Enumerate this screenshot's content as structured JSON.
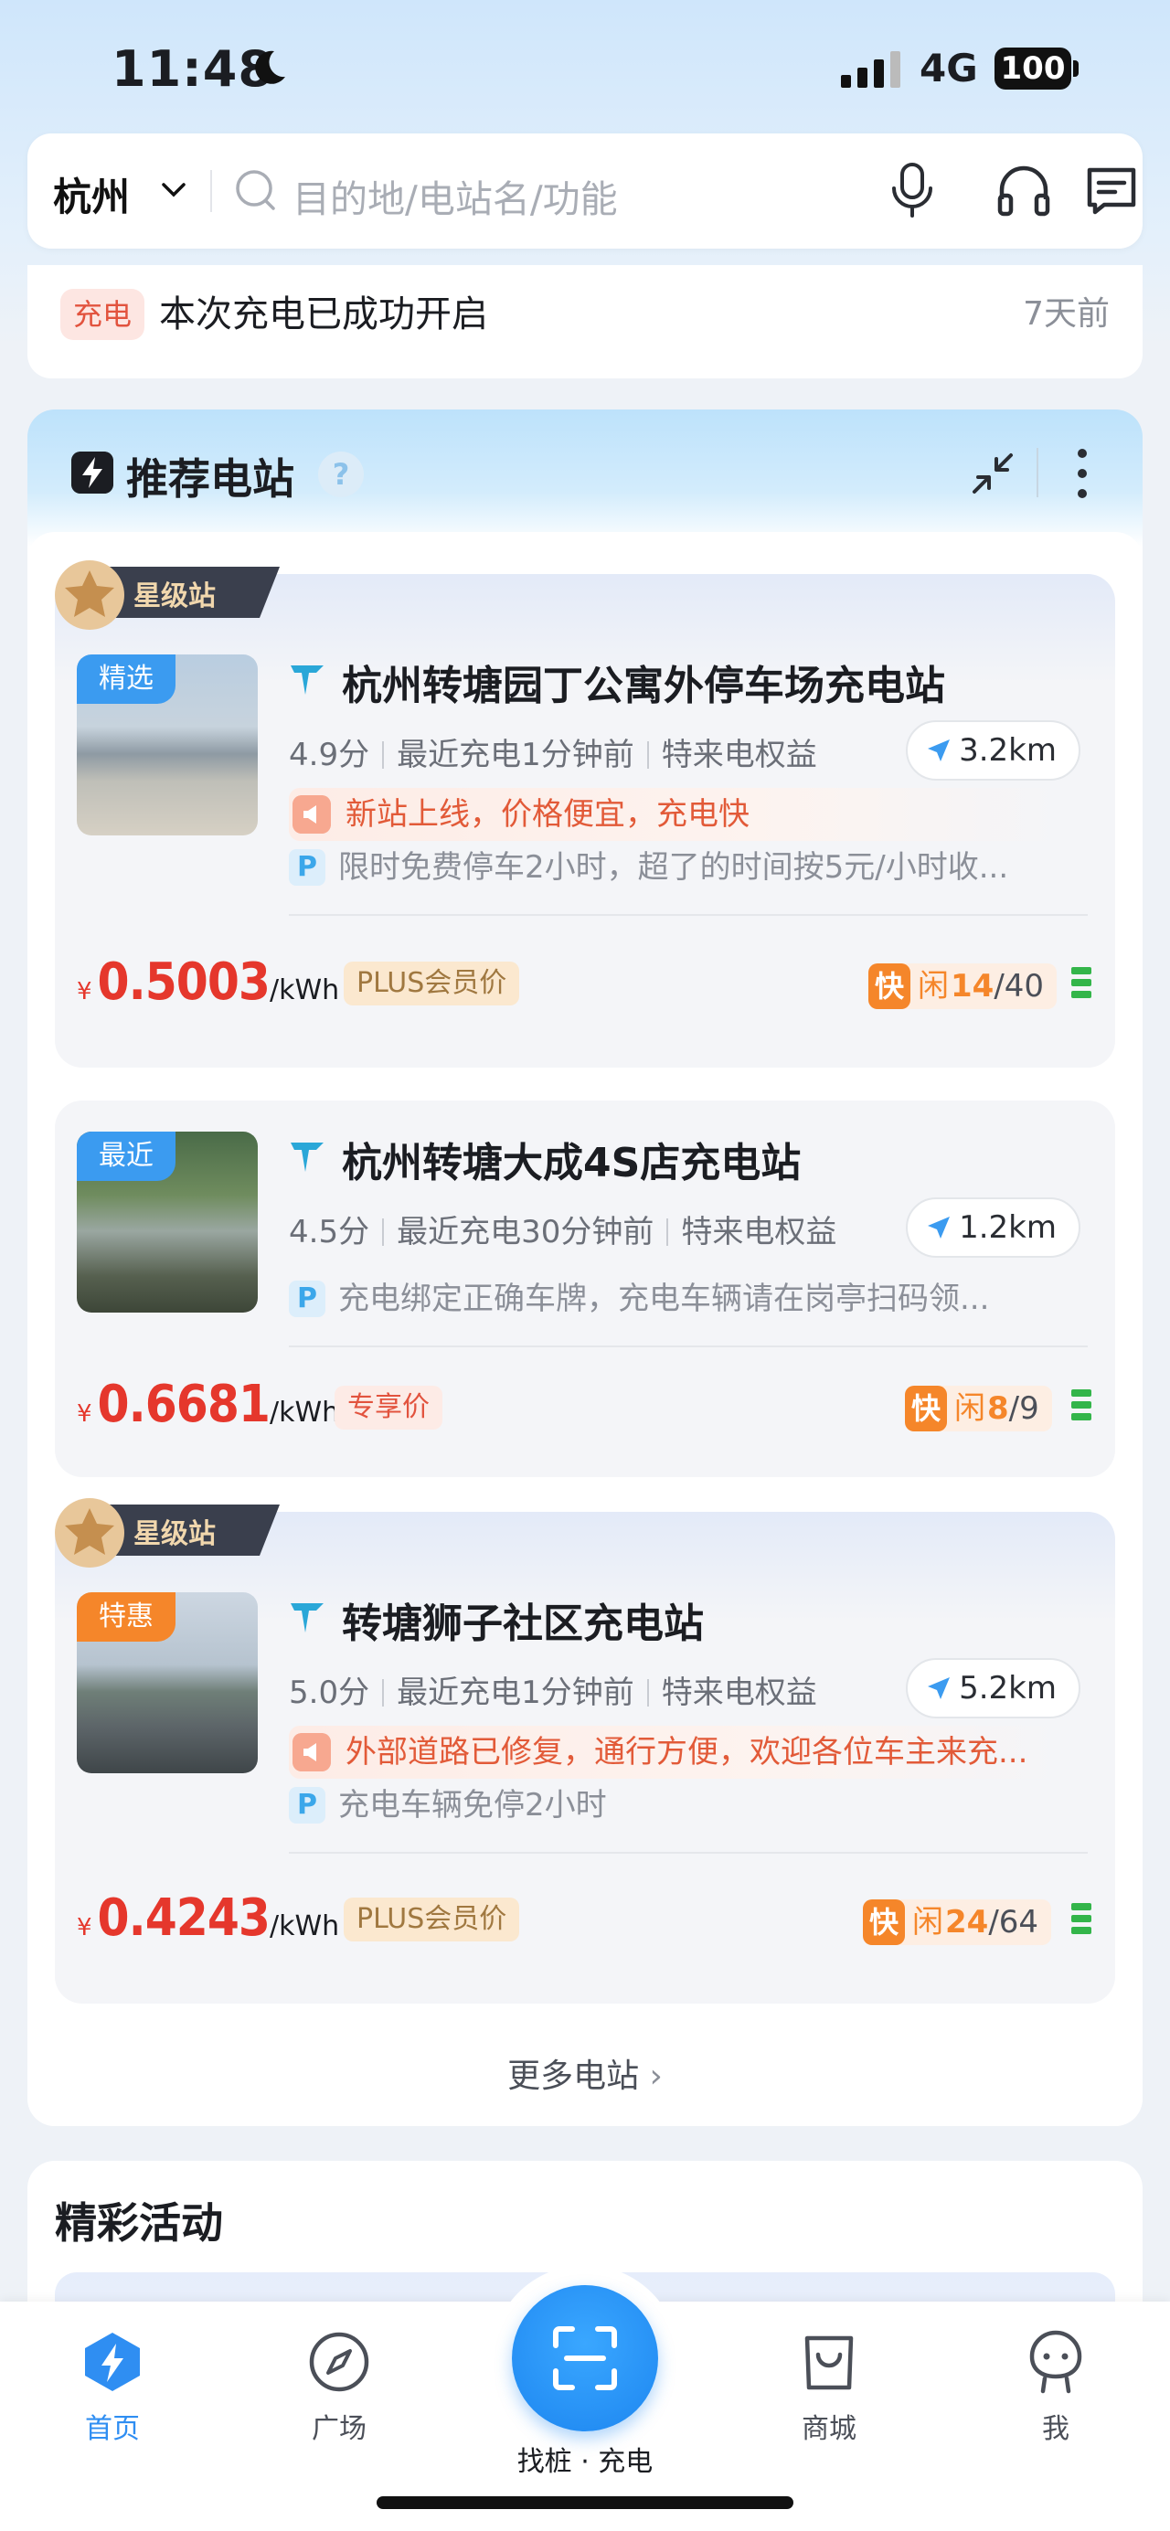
{
  "status_bar": {
    "time": "11:48",
    "network": "4G",
    "battery": "100"
  },
  "search": {
    "city": "杭州",
    "placeholder": "目的地/电站名/功能"
  },
  "notice": {
    "tag": "充电",
    "text": "本次充电已成功开启",
    "time": "7天前"
  },
  "recommend": {
    "title": "推荐电站",
    "help": "?",
    "more_label": "更多电站",
    "star_badge": "星级站",
    "stations": [
      {
        "thumb_tag": "精选",
        "thumb_tag_color": "#3b9bf0",
        "star": true,
        "name": "杭州转塘园丁公寓外停车场充电站",
        "rating": "4.9分",
        "recent": "最近充电1分钟前",
        "benefit": "特来电权益",
        "distance": "3.2km",
        "promo": "新站上线，价格便宜，充电快",
        "parking": "限时免费停车2小时，超了的时间按5元/小时收...",
        "currency": "¥",
        "price": "0.5003",
        "unit": "/kWh",
        "price_tag": "PLUS会员价",
        "fast": "快",
        "idle_label": "闲",
        "free": "14",
        "total": "/40"
      },
      {
        "thumb_tag": "最近",
        "thumb_tag_color": "#3b9bf0",
        "star": false,
        "name": "杭州转塘大成4S店充电站",
        "rating": "4.5分",
        "recent": "最近充电30分钟前",
        "benefit": "特来电权益",
        "distance": "1.2km",
        "promo": "",
        "parking": "充电绑定正确车牌，充电车辆请在岗亭扫码领...",
        "currency": "¥",
        "price": "0.6681",
        "unit": "/kWh",
        "price_tag": "专享价",
        "fast": "快",
        "idle_label": "闲",
        "free": "8",
        "total": "/9"
      },
      {
        "thumb_tag": "特惠",
        "thumb_tag_color": "#f5862a",
        "star": true,
        "name": "转塘狮子社区充电站",
        "rating": "5.0分",
        "recent": "最近充电1分钟前",
        "benefit": "特来电权益",
        "distance": "5.2km",
        "promo": "外部道路已修复，通行方便，欢迎各位车主来充...",
        "parking": "充电车辆免停2小时",
        "currency": "¥",
        "price": "0.4243",
        "unit": "/kWh",
        "price_tag": "PLUS会员价",
        "fast": "快",
        "idle_label": "闲",
        "free": "24",
        "total": "/64"
      }
    ]
  },
  "activities": {
    "title": "精彩活动"
  },
  "tabbar": {
    "home": "首页",
    "plaza": "广场",
    "scan": "找桩 · 充电",
    "mall": "商城",
    "me": "我"
  },
  "colors": {
    "accent": "#2f8ef2",
    "price": "#e5372c",
    "idle": "#f5862a",
    "ok": "#33b54a"
  }
}
